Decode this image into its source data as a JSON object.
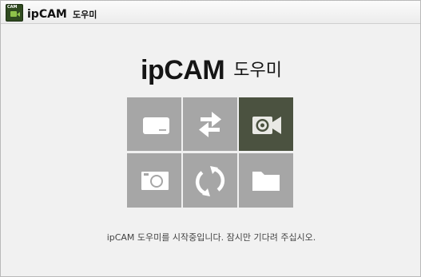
{
  "window": {
    "title_en": "ipCAM",
    "title_ko": "도우미",
    "icon_label": "CAM"
  },
  "logo": {
    "en": "ipCAM",
    "ko": "도우미"
  },
  "tiles": [
    {
      "icon": "tablet-icon",
      "active": false
    },
    {
      "icon": "swap-arrows-icon",
      "active": false
    },
    {
      "icon": "video-camera-icon",
      "active": true
    },
    {
      "icon": "photo-camera-icon",
      "active": false
    },
    {
      "icon": "refresh-icon",
      "active": false
    },
    {
      "icon": "folder-icon",
      "active": false
    }
  ],
  "status": {
    "message": "ipCAM 도우미를 시작중입니다. 잠시만 기다려 주십시오."
  },
  "colors": {
    "tile": "#a6a6a6",
    "tile_active": "#4b5240",
    "background": "#f1f1f1"
  }
}
